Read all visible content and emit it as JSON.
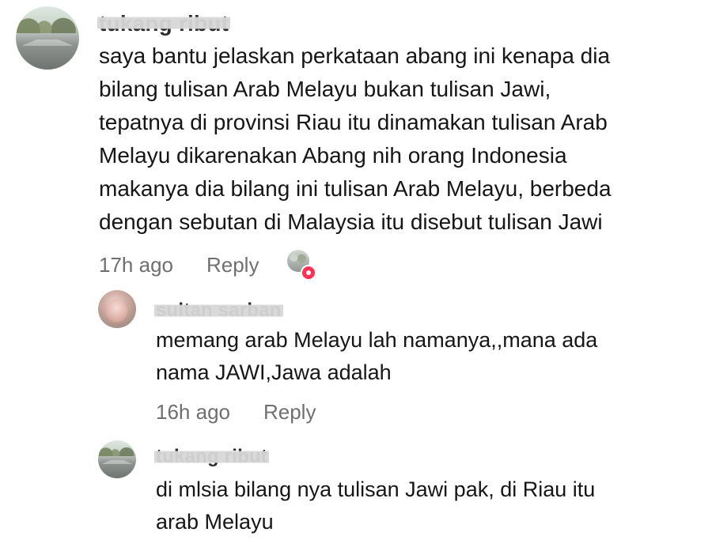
{
  "comments": [
    {
      "username": "tukang ribut",
      "text": "saya bantu jelaskan perkataan abang ini kenapa dia\nbilang tulisan Arab Melayu bukan tulisan Jawi,\ntepatnya di provinsi Riau itu dinamakan tulisan Arab\nMelayu dikarenakan Abang nih orang Indonesia\nmakanya dia bilang ini tulisan Arab Melayu, berbeda\ndengan sebutan di Malaysia itu disebut tulisan Jawi",
      "time": "17h ago",
      "reply_label": "Reply"
    },
    {
      "username": "sultan sarban",
      "text": "memang arab Melayu lah namanya,,mana ada\nnama JAWI,Jawa adalah",
      "time": "16h ago",
      "reply_label": "Reply"
    },
    {
      "username": "tukang ribut",
      "text": "di mlsia bilang nya tulisan Jawi pak, di Riau itu\narab Melayu"
    }
  ],
  "icons": {
    "creator_liked_badge": "creator-liked-icon",
    "heart_badge": "heart-icon"
  },
  "colors": {
    "meta_text": "#707070",
    "like_badge": "#ff2f55",
    "redaction_bar": "#d7d7d7"
  }
}
